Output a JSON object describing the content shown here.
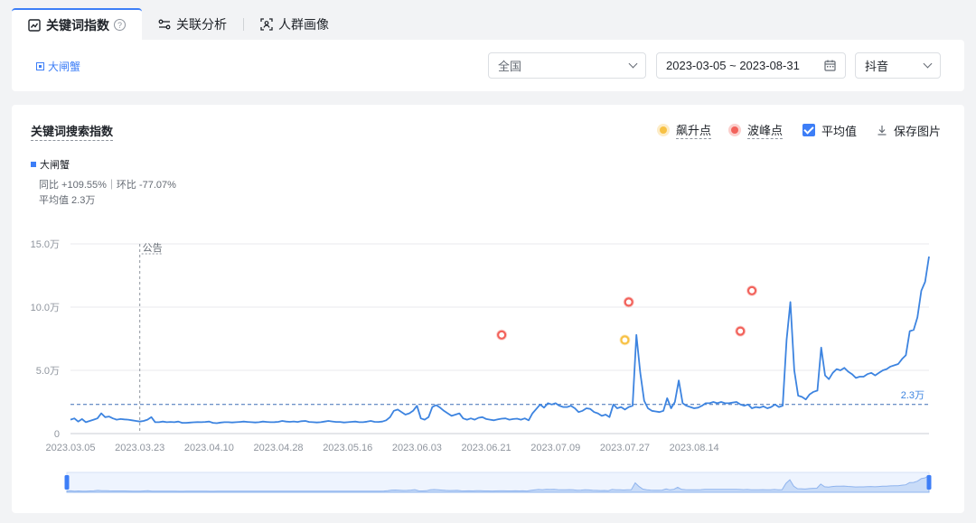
{
  "tabs": [
    {
      "label": "关键词指数",
      "icon": "trend-chart-icon",
      "active": true
    },
    {
      "label": "关联分析",
      "icon": "relation-icon",
      "active": false
    },
    {
      "label": "人群画像",
      "icon": "person-scan-icon",
      "active": false
    }
  ],
  "help_symbol": "?",
  "filters": {
    "keyword": "大闸蟹",
    "region": "全国",
    "date_range": "2023-03-05 ~ 2023-08-31",
    "platform": "抖音"
  },
  "chart_card": {
    "title": "关键词搜索指数",
    "legend": {
      "surge": "飙升点",
      "peak": "波峰点",
      "average": "平均值",
      "save": "保存图片"
    },
    "series_info": {
      "name": "大闸蟹",
      "yoy_mom": "同比 +109.55%｜环比 -77.07%",
      "average": "平均值 2.3万"
    }
  },
  "colors": {
    "accent": "#3d7ef7",
    "line": "#3d84e0",
    "surge": "#f7c144",
    "peak": "#f2625b",
    "grid": "#e8eaed"
  },
  "chart_data": {
    "type": "line",
    "title": "关键词搜索指数",
    "series": [
      {
        "name": "大闸蟹"
      }
    ],
    "x_start": "2023-03-05",
    "x_ticks": [
      "2023.03.05",
      "2023.03.23",
      "2023.04.10",
      "2023.04.28",
      "2023.05.16",
      "2023.06.03",
      "2023.06.21",
      "2023.07.09",
      "2023.07.27",
      "2023.08.14"
    ],
    "y_ticks": [
      "0",
      "5.0万",
      "10.0万",
      "15.0万"
    ],
    "ylim": [
      0,
      150000
    ],
    "average": 23000,
    "average_label": "2.3万",
    "event_marker": {
      "date": "2023-03-23",
      "label": "公告"
    },
    "values": [
      11000,
      12000,
      9500,
      11500,
      9000,
      10000,
      11000,
      12000,
      16000,
      13000,
      13500,
      12000,
      11000,
      11500,
      11200,
      11000,
      10500,
      10000,
      9500,
      10000,
      11000,
      13000,
      9000,
      9000,
      9500,
      9000,
      9200,
      9000,
      9500,
      8500,
      8500,
      8700,
      8900,
      9100,
      9000,
      9200,
      9500,
      8500,
      8200,
      8700,
      9000,
      9000,
      8800,
      9000,
      9200,
      9500,
      9200,
      9000,
      8800,
      9000,
      9500,
      9200,
      9000,
      9100,
      9300,
      10000,
      9500,
      9300,
      9600,
      9200,
      9800,
      10000,
      9200,
      9000,
      8800,
      9000,
      9500,
      10000,
      9600,
      9200,
      9200,
      8800,
      9000,
      9300,
      9500,
      9000,
      9000,
      9400,
      10000,
      9300,
      9200,
      9500,
      10500,
      13000,
      18000,
      19000,
      17000,
      15000,
      16000,
      18000,
      22000,
      12000,
      11000,
      13000,
      21000,
      22500,
      20500,
      18000,
      16000,
      14000,
      15000,
      16000,
      12000,
      11000,
      12000,
      11000,
      12500,
      13000,
      11500,
      11000,
      10500,
      11200,
      11800,
      12000,
      11000,
      11500,
      11800,
      11000,
      12000,
      10500,
      16000,
      19500,
      23000,
      20500,
      24000,
      23000,
      24000,
      22000,
      21000,
      21000,
      22000,
      20000,
      17000,
      18000,
      20000,
      19500,
      17000,
      16000,
      14000,
      15000,
      13000,
      23000,
      20000,
      21000,
      19000,
      21000,
      22000,
      78000,
      48000,
      26000,
      20000,
      18000,
      17500,
      17000,
      18000,
      28000,
      20000,
      25000,
      42000,
      24000,
      22000,
      21000,
      20000,
      20500,
      22000,
      24000,
      24000,
      25000,
      24000,
      25000,
      24000,
      24000,
      24500,
      25000,
      23000,
      22000,
      23000,
      20000,
      21000,
      20500,
      21500,
      20000,
      21000,
      23000,
      21000,
      22000,
      74000,
      104000,
      50000,
      30000,
      29000,
      27000,
      31000,
      33000,
      34000,
      68000,
      46000,
      43000,
      48000,
      51000,
      50000,
      52000,
      49000,
      47000,
      44000,
      45000,
      45000,
      47000,
      48000,
      46000,
      48000,
      50000,
      51000,
      53000,
      54000,
      55000,
      59000,
      62000,
      81000,
      82000,
      92000,
      113000,
      120000,
      140000
    ]
  },
  "markers": {
    "surge": [
      {
        "date": "2023-07-27",
        "value": 74000
      }
    ],
    "peak": [
      {
        "date": "2023-06-25",
        "value": 78000
      },
      {
        "date": "2023-07-28",
        "value": 104000
      },
      {
        "date": "2023-08-26",
        "value": 81000
      },
      {
        "date": "2023-08-29",
        "value": 113000
      }
    ]
  }
}
